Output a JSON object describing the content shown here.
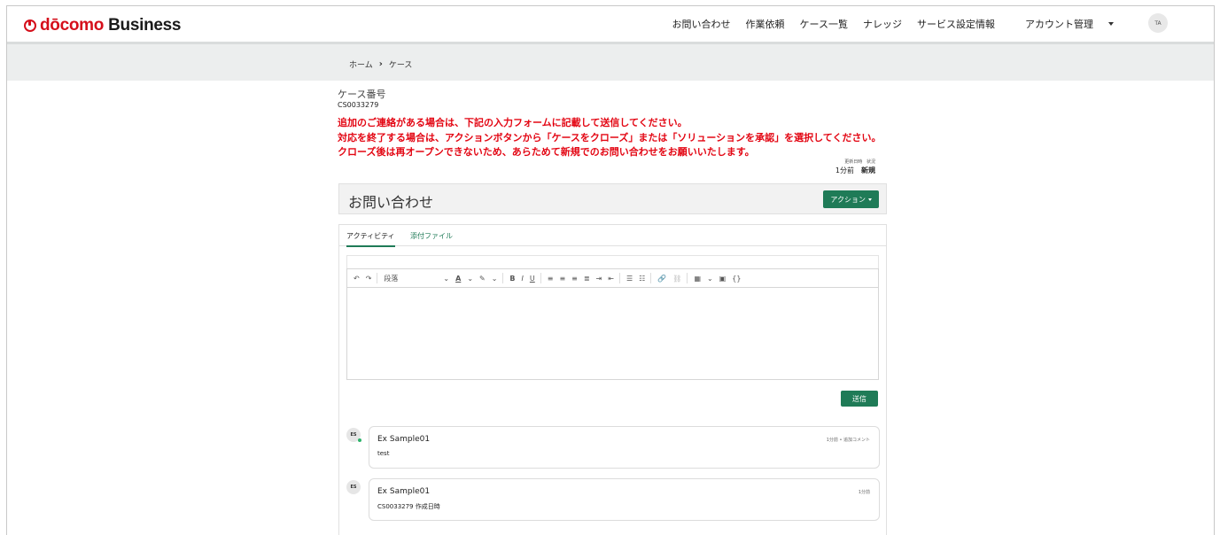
{
  "header": {
    "logo_docomo": "dōcomo",
    "logo_business": "Business",
    "nav": [
      "お問い合わせ",
      "作業依頼",
      "ケース一覧",
      "ナレッジ",
      "サービス設定情報",
      "アカウント管理"
    ],
    "avatar_initials": "TA"
  },
  "breadcrumb": {
    "home": "ホーム",
    "separator": "›",
    "current": "ケース"
  },
  "case": {
    "number_label": "ケース番号",
    "number": "CS0033279",
    "notices": [
      "追加のご連絡がある場合は、下記の入力フォームに記載して送信してください。",
      "対応を終了する場合は、アクションボタンから「ケースをクローズ」または「ソリューションを承認」を選択してください。",
      "クローズ後は再オープンできないため、あらためて新規でのお問い合わせをお願いいたします。"
    ],
    "updated_label": "更新日時",
    "status_label": "状況",
    "updated_value": "1分前",
    "status_value": "新規"
  },
  "title_bar": {
    "title": "お問い合わせ",
    "action_label": "アクション"
  },
  "tabs": {
    "activity": "アクティビティ",
    "attachments": "添付ファイル"
  },
  "editor": {
    "paragraph_label": "段落",
    "send_label": "送信"
  },
  "comments": [
    {
      "initials": "ES",
      "name": "Ex Sample01",
      "meta": "1分前 • 追加コメント",
      "body": "test"
    },
    {
      "initials": "ES",
      "name": "Ex Sample01",
      "meta": "1分前",
      "body": "CS0033279 作成日時"
    }
  ],
  "colors": {
    "brand_red": "#d50f1b",
    "accent_green": "#1f7b57",
    "notice_red": "#e30613"
  }
}
